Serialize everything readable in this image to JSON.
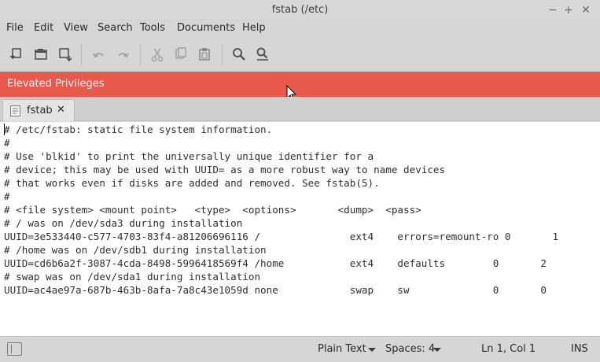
{
  "window": {
    "title": "fstab (/etc)",
    "controls": {
      "minimize": "−",
      "maximize": "+",
      "close": "✕"
    }
  },
  "menu": [
    "File",
    "Edit",
    "View",
    "Search",
    "Tools",
    "Documents",
    "Help"
  ],
  "toolbar": {
    "buttons": [
      "new-document-icon",
      "open-folder-icon",
      "save-icon",
      "undo-icon",
      "redo-icon",
      "cut-icon",
      "copy-icon",
      "paste-icon",
      "find-icon",
      "find-replace-icon"
    ]
  },
  "banner": {
    "text": "Elevated Privileges",
    "color": "#e8594d"
  },
  "tab": {
    "label": "fstab",
    "close": "✕"
  },
  "editor": {
    "lines": [
      "# /etc/fstab: static file system information.",
      "#",
      "# Use 'blkid' to print the universally unique identifier for a",
      "# device; this may be used with UUID= as a more robust way to name devices",
      "# that works even if disks are added and removed. See fstab(5).",
      "#",
      "# <file system> <mount point>   <type>  <options>       <dump>  <pass>",
      "# / was on /dev/sda3 during installation",
      "UUID=3e533440-c577-4703-83f4-a81206696116 /               ext4    errors=remount-ro 0       1",
      "# /home was on /dev/sdb1 during installation",
      "UUID=cd6b6a2f-3087-4cda-8498-5996418569f4 /home           ext4    defaults        0       2",
      "# swap was on /dev/sda1 during installation",
      "UUID=ac4ae97a-687b-463b-8afa-7a8c43e1059d none            swap    sw              0       0"
    ]
  },
  "status": {
    "syntax": "Plain Text",
    "spaces": "Spaces: 4",
    "position": "Ln 1, Col 1",
    "mode": "INS"
  }
}
